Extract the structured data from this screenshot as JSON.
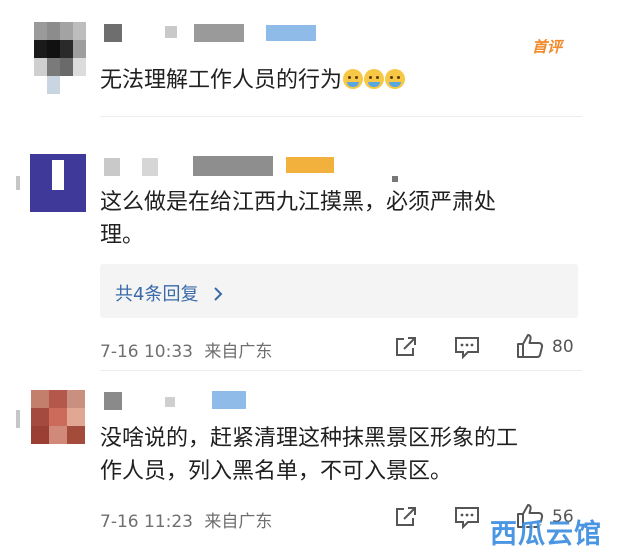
{
  "comments": [
    {
      "badge": "首评",
      "text_lines": [
        "无法理解工作人员的行为"
      ],
      "emoji_count": 3
    },
    {
      "text_lines": [
        "这么做是在给江西九江摸黑，必须严肃处",
        "理。"
      ],
      "replies_label": "共4条回复",
      "time": "7-16 10:33",
      "location": "来自广东",
      "likes": "80"
    },
    {
      "text_lines": [
        "没啥说的，赶紧清理这种抹黑景区形象的工",
        "作人员，列入黑名单，不可入景区。"
      ],
      "time": "7-16 11:23",
      "location": "来自广东",
      "likes": "56"
    }
  ],
  "watermark": "西瓜云馆",
  "icons": [
    "share-icon",
    "comment-icon",
    "thumbs-up-icon",
    "chevron-right-icon"
  ],
  "colors": {
    "link": "#3a6aa8",
    "badge": "#f08a2a",
    "watermark": "#3b8ee0"
  }
}
